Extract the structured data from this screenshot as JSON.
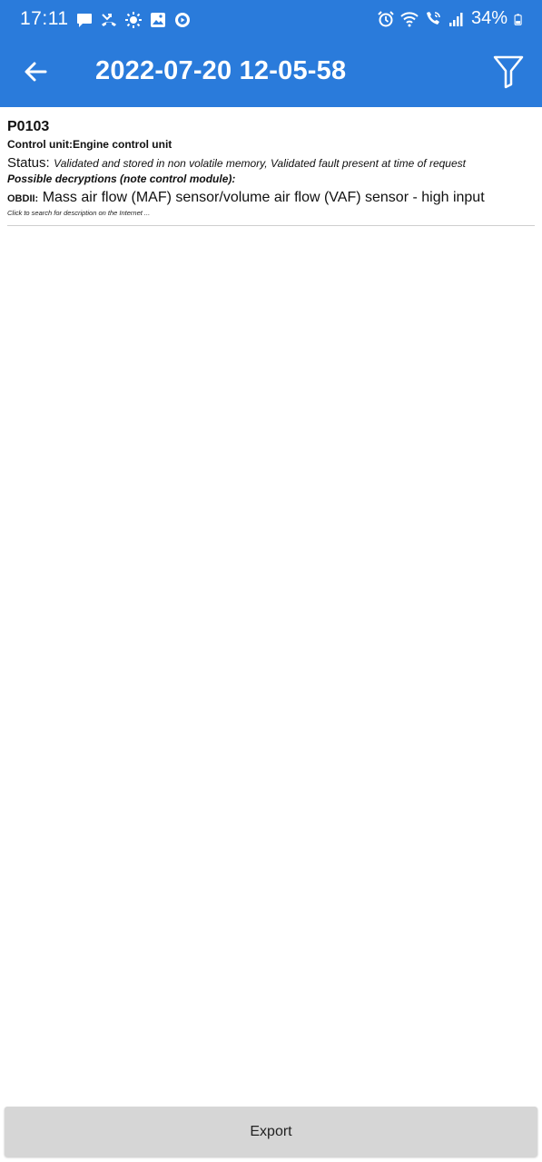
{
  "status_bar": {
    "time": "17:11",
    "battery": "34%",
    "left_icons": [
      "message-icon",
      "missed-call-icon",
      "brightness-icon",
      "image-icon",
      "media-icon"
    ],
    "right_icons": [
      "alarm-icon",
      "wifi-icon",
      "wifi-calling-icon",
      "signal-icon",
      "battery-icon"
    ]
  },
  "toolbar": {
    "title": "2022-07-20 12-05-58",
    "back_icon": "arrow-left-icon",
    "filter_icon": "filter-icon",
    "color": "#2a7bdb"
  },
  "faults": [
    {
      "code": "P0103",
      "control_unit": "Control unit:Engine control unit",
      "status_label": "Status:",
      "status_value": "Validated and stored in non volatile memory, Validated fault present at time of request",
      "decryptions_heading": "Possible decryptions (note control module):",
      "obd_label": "OBDII:",
      "obd_description": "Mass air flow (MAF) sensor/volume air flow (VAF) sensor - high input",
      "search_hint": "Click to search for description on the Internet ..."
    }
  ],
  "footer": {
    "export_label": "Export"
  }
}
